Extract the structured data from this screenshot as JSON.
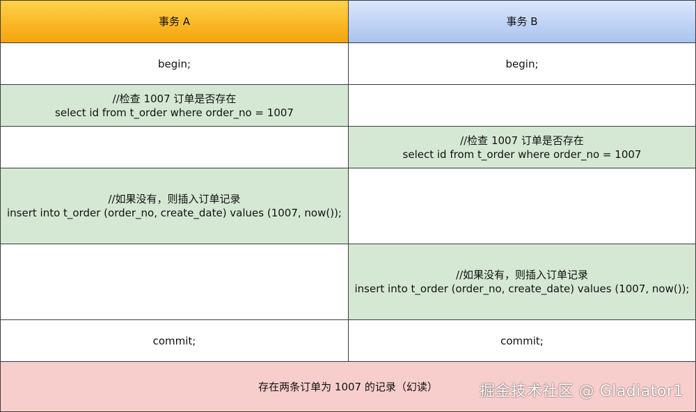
{
  "headers": {
    "a": "事务 A",
    "b": "事务 B"
  },
  "rows": {
    "begin_a": "begin;",
    "begin_b": "begin;",
    "check_a": {
      "comment": "//检查 1007 订单是否存在",
      "sql": "select id from t_order where order_no = 1007"
    },
    "check_b": {
      "comment": "//检查 1007 订单是否存在",
      "sql": "select id from t_order where order_no = 1007"
    },
    "insert_a": {
      "comment": "//如果没有，则插入订单记录",
      "sql": "insert into t_order (order_no, create_date) values (1007, now());"
    },
    "insert_b": {
      "comment": "//如果没有，则插入订单记录",
      "sql": "insert into t_order (order_no, create_date) values (1007, now());"
    },
    "commit_a": "commit;",
    "commit_b": "commit;"
  },
  "result": "存在两条订单为 1007 的记录（幻读）",
  "watermark": "掘金技术社区 @ Gladiator1",
  "colors": {
    "header_a": "#f5a40b",
    "header_b": "#a9c3f0",
    "green_cell": "#d5e8d4",
    "result_cell": "#f8cecc"
  }
}
